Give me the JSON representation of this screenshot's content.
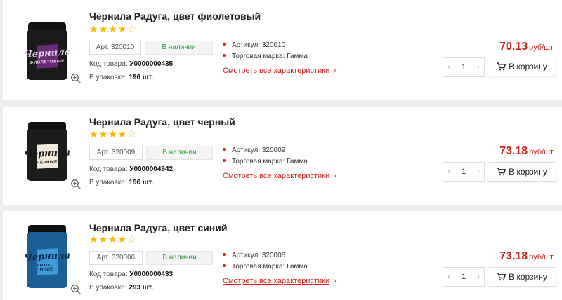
{
  "products": [
    {
      "title": "Чернила Радуга, цвет фиолетовый",
      "stars_filled": "★★★★",
      "stars_empty": "☆",
      "article": "Арт. 320010",
      "availability": "В наличии",
      "code_label": "Код товара:",
      "code": "У0000000435",
      "pack_label": "В упаковке:",
      "pack": "196 шт.",
      "attr1": "Артикул: 320010",
      "attr2": "Торговая марка: Гамма",
      "more": "Смотреть все характеристики",
      "price": "70.13",
      "unit": "руб/шт",
      "qty": "1",
      "cart_label": "В корзину",
      "jar_text": "Чернила",
      "jar_sub": "ФИОЛЕТОВЫЕ",
      "jar_color": "#6b2a78"
    },
    {
      "title": "Чернила Радуга, цвет черный",
      "stars_filled": "★★★★",
      "stars_empty": "☆",
      "article": "Арт. 320009",
      "availability": "В наличии",
      "code_label": "Код товара:",
      "code": "У0000004942",
      "pack_label": "В упаковке:",
      "pack": "196 шт.",
      "attr1": "Артикул: 320009",
      "attr2": "Торговая марка: Гамма",
      "more": "Смотреть все характеристики",
      "price": "73.18",
      "unit": "руб/шт",
      "qty": "1",
      "cart_label": "В корзину",
      "jar_text": "Чернила",
      "jar_sub": "ЧЁРНЫЕ",
      "jar_color": "#2a2a2a"
    },
    {
      "title": "Чернила Радуга, цвет синий",
      "stars_filled": "★★★★",
      "stars_empty": "☆",
      "article": "Арт. 320006",
      "availability": "В наличии",
      "code_label": "Код товара:",
      "code": "У0000000433",
      "pack_label": "В упаковке:",
      "pack": "293 шт.",
      "attr1": "Артикул: 320006",
      "attr2": "Торговая марка: Гамма",
      "more": "Смотреть все характеристики",
      "price": "73.18",
      "unit": "руб/шт",
      "qty": "1",
      "cart_label": "В корзину",
      "jar_text": "Чернила",
      "jar_sub": "ЯРКО-СИНИЕ",
      "jar_color": "#2f78b5"
    }
  ],
  "icons": {
    "zoom": "zoom-in-icon",
    "cart": "cart-icon",
    "minus": "chevron-left-icon",
    "plus": "chevron-right-icon",
    "more": "chevron-right-icon"
  },
  "colors": {
    "accent": "#d0211c",
    "price": "#c8221d",
    "available": "#2e9e3c",
    "star": "#f5b800"
  }
}
